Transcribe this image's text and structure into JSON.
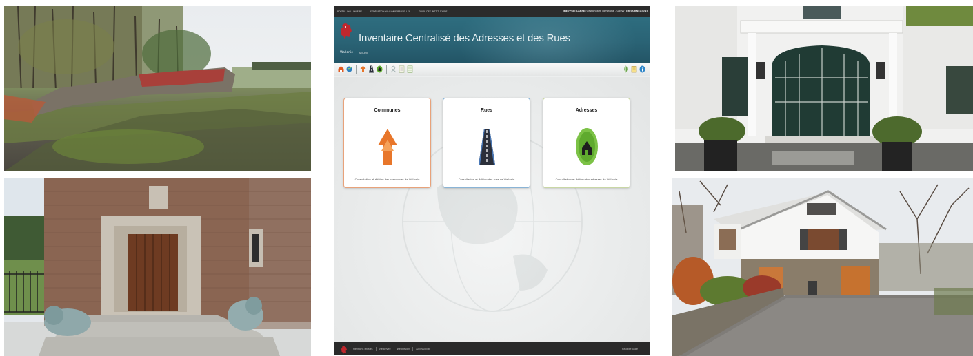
{
  "app": {
    "topnav": [
      "Portail Wallonie.be",
      "Fédération Wallonie-Bruxelles",
      "Guide des institutions"
    ],
    "user": {
      "name": "Jean-Paul CARRE",
      "role": "(Gestionnaire communal - Gouvy)",
      "logout": "[DÉCONNEXION]"
    },
    "title": "Inventaire Centralisé des Adresses et des Rues",
    "region": "Wallonie",
    "breadcrumb": "Accueil",
    "cards": [
      {
        "title": "Communes",
        "description": "Consultation et édition des communes de Wallonie",
        "accent": "#e8a27a",
        "icon": "commune-arrow-icon"
      },
      {
        "title": "Rues",
        "description": "Consultation et édition des rues de Wallonie",
        "accent": "#8ab4d6",
        "icon": "road-icon"
      },
      {
        "title": "Adresses",
        "description": "Consultation et édition des adresses de Wallonie",
        "accent": "#c9d7a5",
        "icon": "address-house-icon"
      }
    ],
    "footer": {
      "links": [
        "Mentions légales",
        "Vie privée",
        "Webdesign",
        "Accessibilité"
      ],
      "top": "Haut de page"
    }
  },
  "colors": {
    "banner": "#2a6375",
    "topnav": "#2b2b2b",
    "footer": "#2a2a2a",
    "brand": "#c0272d"
  }
}
